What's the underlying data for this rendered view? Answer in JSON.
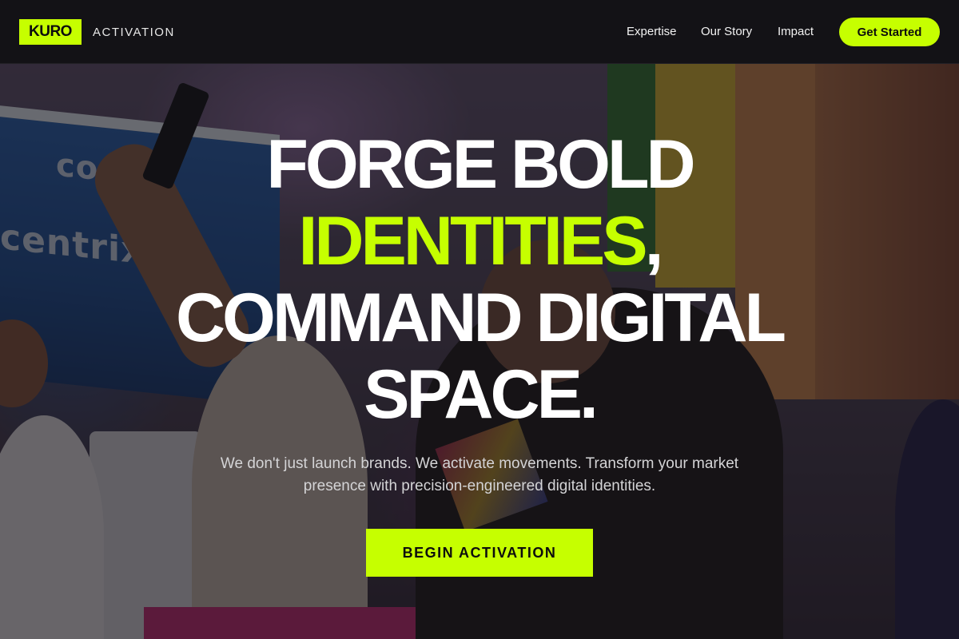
{
  "brand": {
    "logo": "KURO",
    "tagline": "ACTIVATION"
  },
  "nav": {
    "links": [
      "Expertise",
      "Our Story",
      "Impact"
    ],
    "cta": "Get Started"
  },
  "hero": {
    "title_line1": "FORGE BOLD",
    "title_line2_accent": "IDENTITIES",
    "title_line2_rest": ",",
    "title_line3": "COMMAND DIGITAL",
    "title_line4": "SPACE.",
    "subtitle": "We don't just launch brands. We activate movements. Transform your market presence with precision-engineered digital identities.",
    "cta": "BEGIN ACTIVATION",
    "background_texts": [
      "conca",
      "centrix"
    ]
  },
  "colors": {
    "accent": "#c6ff00",
    "nav_bg": "#131216",
    "text": "#ffffff"
  }
}
